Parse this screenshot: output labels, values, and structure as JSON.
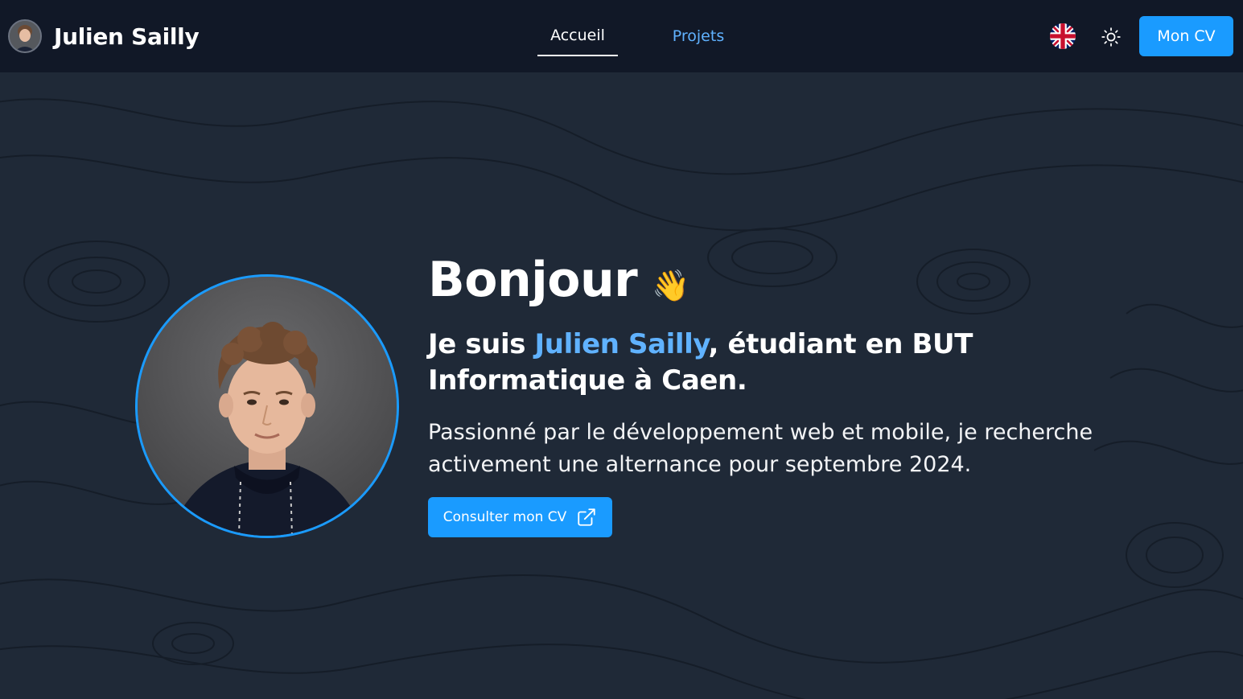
{
  "header": {
    "brand_name": "Julien Sailly",
    "nav": [
      {
        "label": "Accueil",
        "active": true
      },
      {
        "label": "Projets",
        "active": false
      }
    ],
    "language_icon": "uk-flag-icon",
    "theme_icon": "sun-icon",
    "cv_button_label": "Mon CV"
  },
  "hero": {
    "greeting": "Bonjour",
    "greeting_emoji": "👋",
    "intro_prefix": "Je suis ",
    "intro_name": "Julien Sailly",
    "intro_suffix": ", étudiant en BUT Informatique à Caen.",
    "description": "Passionné par le développement web et mobile, je recherche activement une alternance pour septembre 2024.",
    "cta_label": "Consulter mon CV",
    "cta_icon": "external-link-icon"
  },
  "colors": {
    "header_bg": "#111827",
    "page_bg": "#1f2937",
    "accent": "#1a9bff",
    "highlight_text": "#60b2ff"
  }
}
